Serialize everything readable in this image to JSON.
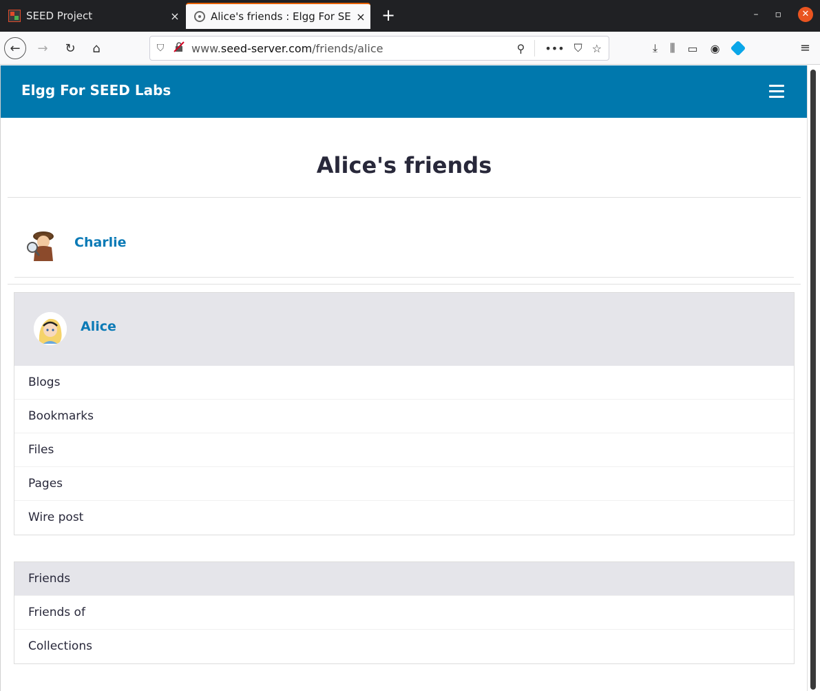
{
  "browser": {
    "tabs": [
      {
        "title": "SEED Project",
        "close": "×"
      },
      {
        "title": "Alice's friends : Elgg For SEED Labs",
        "close": "×"
      }
    ],
    "new_tab": "+",
    "window": {
      "minimize": "–",
      "restore": "▫",
      "close": "✕"
    },
    "url": {
      "prefix": "www.",
      "host": "seed-server.com",
      "path": "/friends/alice"
    },
    "icons": {
      "back": "←",
      "forward": "→",
      "reload": "↻",
      "home": "⌂",
      "shield": "⛉",
      "insecure": "🔒",
      "key": "⚲",
      "more": "•••",
      "pocket": "⛉",
      "bookmark": "☆",
      "download": "⤓",
      "library": "⫼",
      "sidebar": "▭",
      "account": "◉",
      "menu": "≡"
    }
  },
  "site": {
    "title": "Elgg For SEED Labs",
    "brand_color": "#0078ad"
  },
  "page": {
    "title": "Alice's friends",
    "friends": [
      {
        "name": "Charlie"
      }
    ],
    "owner": {
      "name": "Alice",
      "menu": [
        "Blogs",
        "Bookmarks",
        "Files",
        "Pages",
        "Wire post"
      ]
    },
    "friends_menu": [
      {
        "label": "Friends",
        "selected": true
      },
      {
        "label": "Friends of",
        "selected": false
      },
      {
        "label": "Collections",
        "selected": false
      }
    ]
  }
}
